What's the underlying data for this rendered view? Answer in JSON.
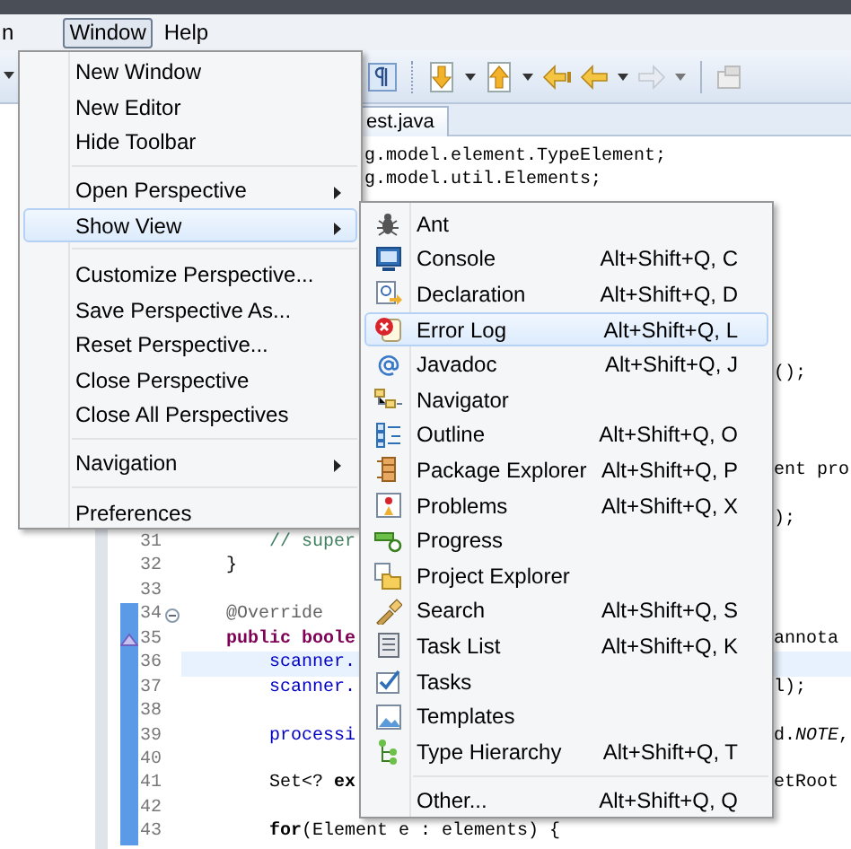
{
  "menu_bar": [
    {
      "label": "n",
      "selected": false
    },
    {
      "label": "Window",
      "selected": true
    },
    {
      "label": "Help",
      "selected": false
    }
  ],
  "editor_tab": {
    "label": "est.java"
  },
  "code_lines": [
    {
      "kind": "plain",
      "right": "g.model.element.TypeElement;"
    },
    {
      "kind": "plain",
      "right": "g.model.util.Elements;"
    },
    {
      "kind": "plain"
    },
    {
      "kind": "plain"
    },
    {
      "kind": "plain"
    },
    {
      "kind": "plain"
    },
    {
      "kind": "plain"
    },
    {
      "kind": "plain"
    },
    {
      "kind": "plain"
    },
    {
      "kind": "plain",
      "right": "();"
    },
    {
      "kind": "plain"
    },
    {
      "kind": "plain"
    },
    {
      "kind": "plain"
    },
    {
      "kind": "plain",
      "right": "ent pro"
    },
    {
      "kind": "plain"
    },
    {
      "kind": "plain",
      "right": ");"
    },
    {
      "kind": "plain",
      "number": "31",
      "text": "        // super",
      "color": "#3f7f5f",
      "scope": false,
      "current": false
    },
    {
      "kind": "plain",
      "number": "32",
      "text": "    }",
      "color": "#000000",
      "scope": false,
      "current": false
    },
    {
      "kind": "plain",
      "number": "33",
      "scope": false,
      "current": false
    },
    {
      "kind": "fold",
      "number": "34",
      "text": "    @Override",
      "color": "#646464",
      "scope": true,
      "current": false
    },
    {
      "kind": "override",
      "number": "35",
      "text": "    **public** **boole**",
      "color": "#7f0055",
      "right": "annota",
      "scope": true,
      "current": false
    },
    {
      "kind": "plain",
      "number": "36",
      "text": "        scanner.",
      "color": "#0000c0",
      "scope": true,
      "current": true
    },
    {
      "kind": "plain",
      "number": "37",
      "text": "        scanner.",
      "color": "#0000c0",
      "right": "l);",
      "scope": true,
      "current": false
    },
    {
      "kind": "plain",
      "number": "38",
      "scope": true,
      "current": false
    },
    {
      "kind": "plain",
      "number": "39",
      "text": "        processi",
      "color": "#0000c0",
      "right": "d.*NOTE*,",
      "scope": true,
      "current": false
    },
    {
      "kind": "plain",
      "number": "40",
      "scope": true,
      "current": false
    },
    {
      "kind": "plain",
      "number": "41",
      "text": "        Set<? **ex**",
      "color": "#000000",
      "right": "etRoot",
      "scope": true,
      "current": false
    },
    {
      "kind": "plain",
      "number": "42",
      "scope": true,
      "current": false
    },
    {
      "kind": "plain",
      "number": "43",
      "text": "        **for**(Element e : elements) {",
      "color": "#000000",
      "scope": true,
      "current": false
    }
  ],
  "window_menu": {
    "items": [
      {
        "kind": "item",
        "label": "New Window",
        "has_submenu": false,
        "selected": false
      },
      {
        "kind": "item",
        "label": "New Editor",
        "has_submenu": false,
        "selected": false
      },
      {
        "kind": "item",
        "label": "Hide Toolbar",
        "has_submenu": false,
        "selected": false
      },
      {
        "kind": "separator"
      },
      {
        "kind": "item",
        "label": "Open Perspective",
        "has_submenu": true,
        "selected": false
      },
      {
        "kind": "item",
        "label": "Show View",
        "has_submenu": true,
        "selected": true
      },
      {
        "kind": "separator"
      },
      {
        "kind": "item",
        "label": "Customize Perspective...",
        "has_submenu": false,
        "selected": false
      },
      {
        "kind": "item",
        "label": "Save Perspective As...",
        "has_submenu": false,
        "selected": false
      },
      {
        "kind": "item",
        "label": "Reset Perspective...",
        "has_submenu": false,
        "selected": false
      },
      {
        "kind": "item",
        "label": "Close Perspective",
        "has_submenu": false,
        "selected": false
      },
      {
        "kind": "item",
        "label": "Close All Perspectives",
        "has_submenu": false,
        "selected": false
      },
      {
        "kind": "separator"
      },
      {
        "kind": "item",
        "label": "Navigation",
        "has_submenu": true,
        "selected": false
      },
      {
        "kind": "separator"
      },
      {
        "kind": "item",
        "label": "Preferences",
        "has_submenu": false,
        "selected": false
      }
    ]
  },
  "show_view_menu": {
    "items": [
      {
        "kind": "item",
        "label": "Ant",
        "selected": false
      },
      {
        "kind": "item",
        "label": "Console",
        "shortcut": "Alt+Shift+Q, C",
        "selected": false
      },
      {
        "kind": "item",
        "label": "Declaration",
        "shortcut": "Alt+Shift+Q, D",
        "selected": false
      },
      {
        "kind": "item",
        "label": "Error Log",
        "shortcut": "Alt+Shift+Q, L",
        "selected": true
      },
      {
        "kind": "item",
        "label": "Javadoc",
        "shortcut": "Alt+Shift+Q, J",
        "selected": false
      },
      {
        "kind": "item",
        "label": "Navigator",
        "selected": false
      },
      {
        "kind": "item",
        "label": "Outline",
        "shortcut": "Alt+Shift+Q, O",
        "selected": false
      },
      {
        "kind": "item",
        "label": "Package Explorer",
        "shortcut": "Alt+Shift+Q, P",
        "selected": false
      },
      {
        "kind": "item",
        "label": "Problems",
        "shortcut": "Alt+Shift+Q, X",
        "selected": false
      },
      {
        "kind": "item",
        "label": "Progress",
        "selected": false
      },
      {
        "kind": "item",
        "label": "Project Explorer",
        "selected": false
      },
      {
        "kind": "item",
        "label": "Search",
        "shortcut": "Alt+Shift+Q, S",
        "selected": false
      },
      {
        "kind": "item",
        "label": "Task List",
        "shortcut": "Alt+Shift+Q, K",
        "selected": false
      },
      {
        "kind": "item",
        "label": "Tasks",
        "selected": false
      },
      {
        "kind": "item",
        "label": "Templates",
        "selected": false
      },
      {
        "kind": "item",
        "label": "Type Hierarchy",
        "shortcut": "Alt+Shift+Q, T",
        "selected": false
      },
      {
        "kind": "separator"
      },
      {
        "kind": "item",
        "label": "Other...",
        "shortcut": "Alt+Shift+Q, Q",
        "selected": false
      }
    ]
  }
}
